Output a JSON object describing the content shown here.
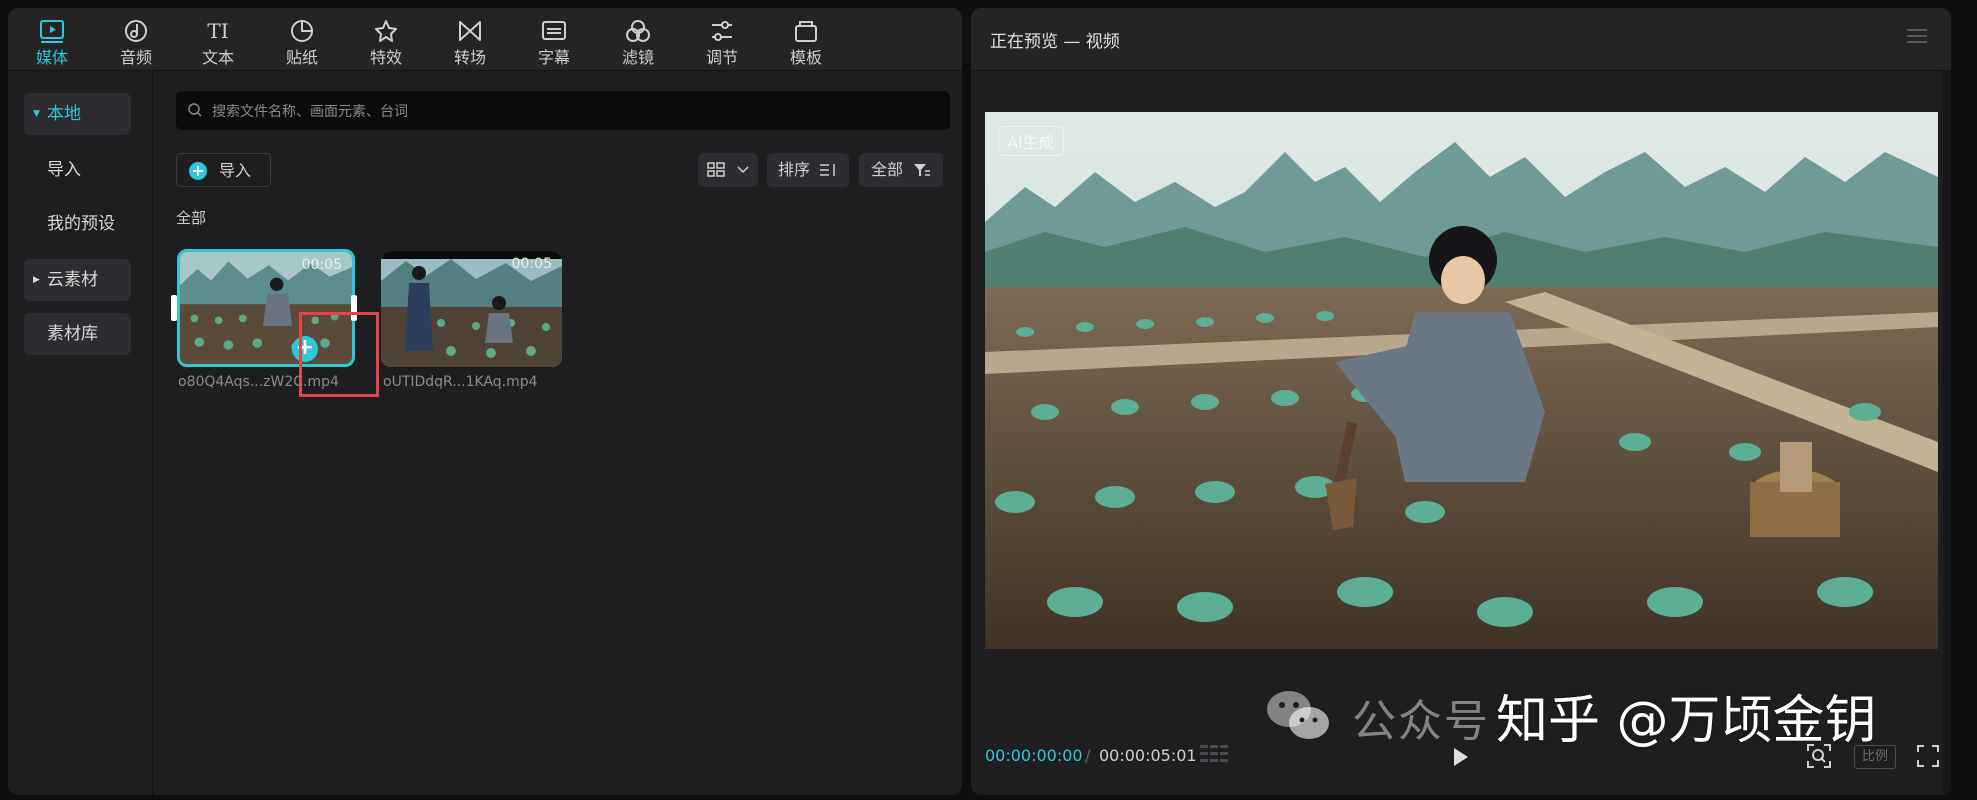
{
  "toolbar": {
    "items": [
      {
        "label": "媒体",
        "icon": "media-icon",
        "active": true
      },
      {
        "label": "音频",
        "icon": "audio-icon"
      },
      {
        "label": "文本",
        "icon": "text-icon"
      },
      {
        "label": "贴纸",
        "icon": "sticker-icon"
      },
      {
        "label": "特效",
        "icon": "effects-icon"
      },
      {
        "label": "转场",
        "icon": "transition-icon"
      },
      {
        "label": "字幕",
        "icon": "subtitle-icon"
      },
      {
        "label": "滤镜",
        "icon": "filter-icon"
      },
      {
        "label": "调节",
        "icon": "adjust-icon"
      },
      {
        "label": "模板",
        "icon": "template-icon"
      }
    ],
    "accent_color": "#2ec8d6"
  },
  "sidebar": {
    "items": [
      {
        "label": "本地",
        "expanded": true,
        "selected": true
      },
      {
        "label": "导入"
      },
      {
        "label": "我的预设"
      },
      {
        "label": "云素材",
        "expanded": false
      },
      {
        "label": "素材库"
      }
    ]
  },
  "media": {
    "search_placeholder": "搜索文件名称、画面元素、台词",
    "import_label": "导入",
    "sort_label": "排序",
    "filter_label": "全部",
    "section_label": "全部",
    "clips": [
      {
        "name": "o80Q4Aqs...zW2C.mp4",
        "duration": "00:05",
        "selected": true
      },
      {
        "name": "oUTIDdqR...1KAq.mp4",
        "duration": "00:05"
      }
    ]
  },
  "preview": {
    "title": "正在预览 — 视频",
    "ai_badge": "AI生成",
    "current_time": "00:00:00:00",
    "total_time": "00:00:05:01",
    "ratio_label": "比例"
  },
  "watermark": {
    "wechat_text": "公众号",
    "zhihu_text": "知乎 @万顷金钥"
  }
}
